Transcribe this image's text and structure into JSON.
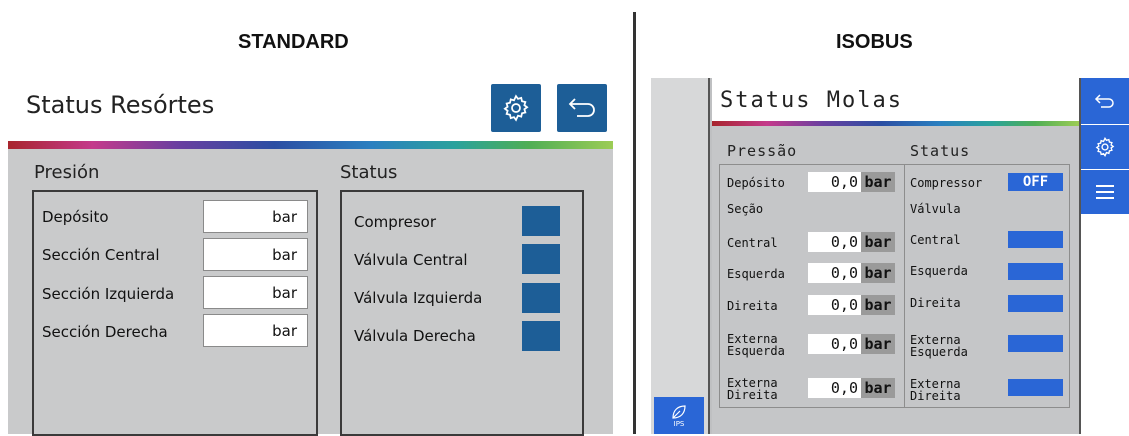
{
  "headers": {
    "standard": "STANDARD",
    "isobus": "ISOBUS"
  },
  "standard": {
    "title": "Status Resórtes",
    "pressure_label": "Presión",
    "status_label": "Status",
    "pressure_rows": [
      {
        "label": "Depósito",
        "unit": "bar"
      },
      {
        "label": "Sección Central",
        "unit": "bar"
      },
      {
        "label": "Sección Izquierda",
        "unit": "bar"
      },
      {
        "label": "Sección Derecha",
        "unit": "bar"
      }
    ],
    "status_rows": [
      {
        "label": "Compresor"
      },
      {
        "label": "Válvula Central"
      },
      {
        "label": "Válvula Izquierda"
      },
      {
        "label": "Válvula Derecha"
      }
    ],
    "icons": {
      "settings": "gear-icon",
      "back": "back-arrow-icon"
    },
    "colors": {
      "button": "#1d5e97",
      "panel": "#c9cacb"
    }
  },
  "isobus": {
    "title": "Status Molas",
    "pressure_label": "Pressão",
    "status_label": "Status",
    "deposit": {
      "label": "Depósito",
      "value": "0,0",
      "unit": "bar"
    },
    "section_label": "Seção",
    "pressure_rows": [
      {
        "label_1": "Central",
        "label_2": "",
        "value": "0,0",
        "unit": "bar"
      },
      {
        "label_1": "Esquerda",
        "label_2": "",
        "value": "0,0",
        "unit": "bar"
      },
      {
        "label_1": "Direita",
        "label_2": "",
        "value": "0,0",
        "unit": "bar"
      },
      {
        "label_1": "Externa",
        "label_2": "Esquerda",
        "value": "0,0",
        "unit": "bar"
      },
      {
        "label_1": "Externa",
        "label_2": "Direita",
        "value": "0,0",
        "unit": "bar"
      }
    ],
    "compressor": {
      "label": "Compressor",
      "state": "OFF"
    },
    "valve_label": "Válvula",
    "status_rows": [
      {
        "label_1": "Central",
        "label_2": ""
      },
      {
        "label_1": "Esquerda",
        "label_2": ""
      },
      {
        "label_1": "Direita",
        "label_2": ""
      },
      {
        "label_1": "Externa",
        "label_2": "Esquerda"
      },
      {
        "label_1": "Externa",
        "label_2": "Direita"
      }
    ],
    "ips_label": "IPS",
    "icons": {
      "back": "back-arrow-icon",
      "settings": "gear-icon",
      "menu": "menu-icon",
      "ips": "leaf-icon"
    },
    "colors": {
      "button": "#2a66d6",
      "panel": "#c5c6c8"
    }
  }
}
